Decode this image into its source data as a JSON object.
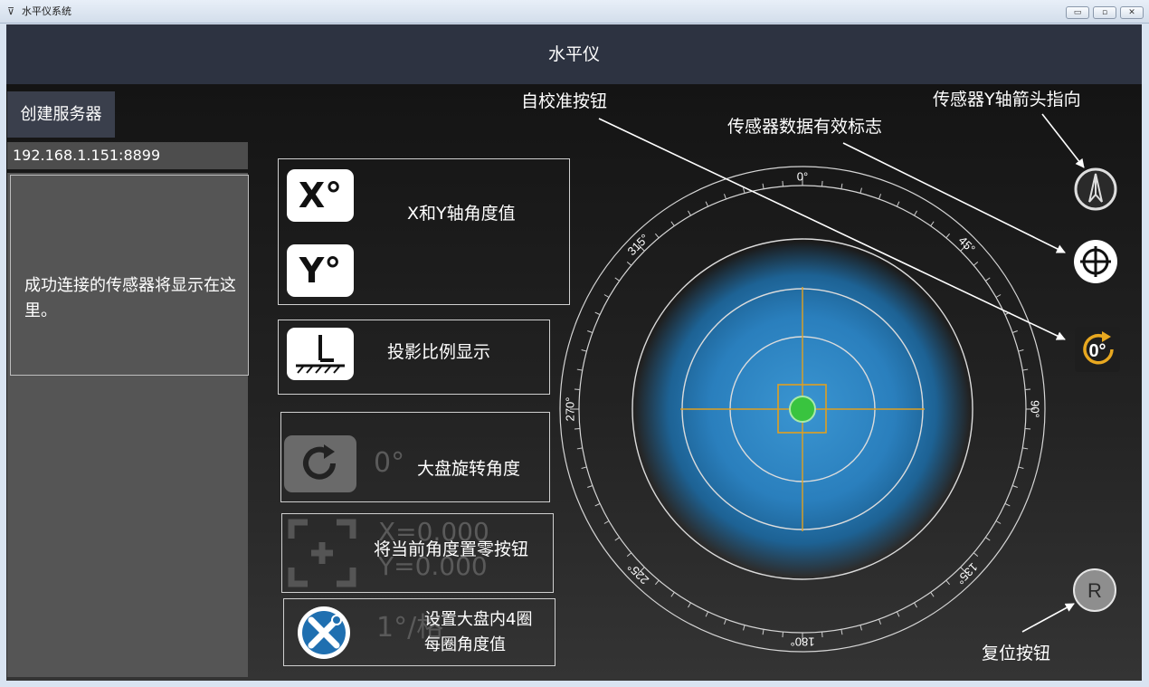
{
  "window": {
    "title": "水平仪系统",
    "controls": {
      "minimize": "▭",
      "maximize": "▫",
      "close": "✕"
    }
  },
  "header": {
    "title": "水平仪"
  },
  "left_panel": {
    "create_server_label": "创建服务器",
    "server_address": "192.168.1.151:8899",
    "sensor_placeholder": "成功连接的传感器将显示在这里。"
  },
  "features": {
    "angle_values": {
      "x_icon": "X°",
      "y_icon": "Y°",
      "label": "X和Y轴角度值"
    },
    "projection": {
      "label": "投影比例显示",
      "icon": "projection-icon"
    },
    "rotation": {
      "value": "0°",
      "label": "大盘旋转角度",
      "icon": "rotate-icon"
    },
    "zero": {
      "x_value": "X=0.000",
      "y_value": "Y=0.000",
      "label": "将当前角度置零按钮",
      "icon": "crosshair-frame-icon"
    },
    "ring_setting": {
      "value": "1°/格",
      "label_line1": "设置大盘内4圈",
      "label_line2": "每圈角度值",
      "icon": "tools-icon"
    }
  },
  "dial": {
    "labels": [
      "0°",
      "45°",
      "90°",
      "135°",
      "180°",
      "225°",
      "270°",
      "315°"
    ],
    "bubble_color": "#39c43f",
    "field_color": "#2e86c4",
    "crosshair_color": "#e0a020"
  },
  "right_buttons": {
    "self_calibrate_label": "0°",
    "reset_label": "R"
  },
  "annotations": {
    "self_calibrate": "自校准按钮",
    "sensor_valid": "传感器数据有效标志",
    "sensor_y_arrow": "传感器Y轴箭头指向",
    "reset": "复位按钮"
  },
  "colors": {
    "accent_orange": "#e8a820",
    "header_bg": "#2d3341"
  }
}
